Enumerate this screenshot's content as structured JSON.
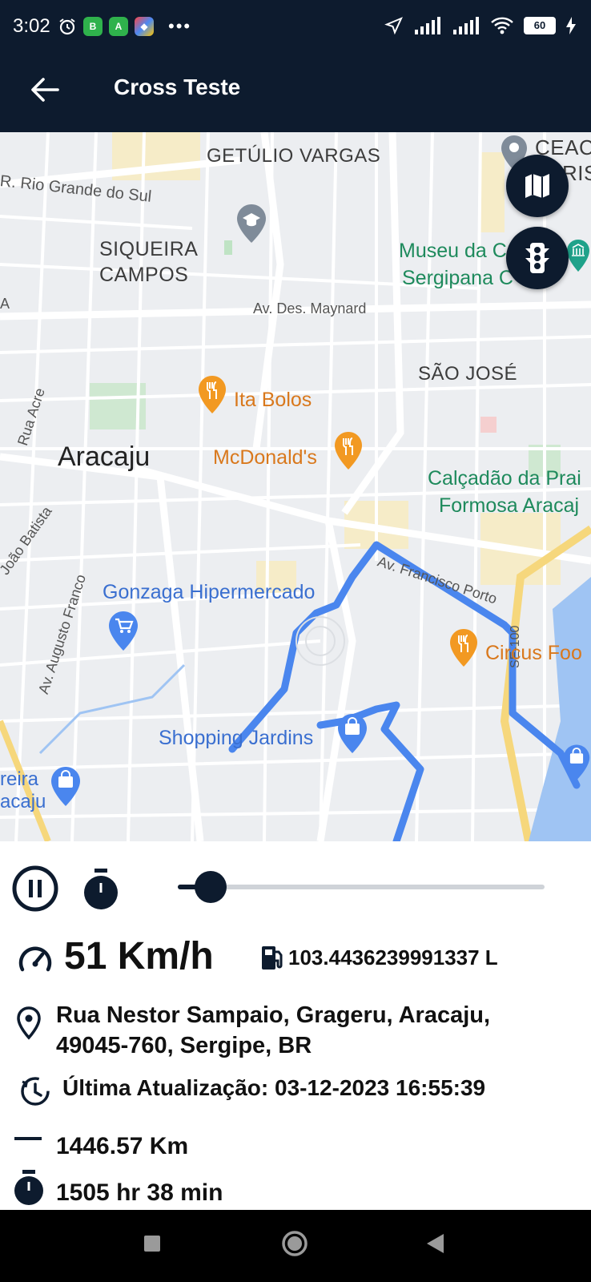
{
  "status_bar": {
    "time": "3:02",
    "battery": "60"
  },
  "app_bar": {
    "title": "Cross Teste"
  },
  "map": {
    "labels": {
      "getulio_vargas": "GETÚLIO VARGAS",
      "ceac": "CEAC",
      "ris": "RIS",
      "rio_grande_do_sul": "R. Rio Grande do Sul",
      "siqueira": "SIQUEIRA",
      "campos": "CAMPOS",
      "museu_line1": "Museu da C",
      "museu_line2": "Sergipana C",
      "av_maynard": "Av. Des. Maynard",
      "a": "A",
      "sao_jose": "SÃO JOSÉ",
      "rua_acre": "Rua Acre",
      "ita_bolos": "Ita Bolos",
      "aracaju": "Aracaju",
      "mcdonalds": "McDonald's",
      "calcadao_line1": "Calçadão da Prai",
      "calcadao_line2": "Formosa Aracaj",
      "joao_batista": "João Batista",
      "av_francisco_porto": "Av. Francisco Porto",
      "gonzaga": "Gonzaga Hipermercado",
      "av_augusto_franco": "Av. Augusto Franco",
      "se_100": "SE-100",
      "circus": "Circus Foo",
      "shopping_jardins": "Shopping Jardins",
      "reira": "reira",
      "acaju": "acaju"
    }
  },
  "colors": {
    "primary": "#0d1b2e",
    "route": "#4a86ee",
    "map_bg": "#eceef1"
  },
  "playback": {
    "progress": 0.09
  },
  "info": {
    "speed": "51 Km/h",
    "fuel": "103.4436239991337 L",
    "address": "Rua Nestor Sampaio, Grageru, Aracaju, 49045-760, Sergipe, BR",
    "last_update": "Última Atualização: 03-12-2023 16:55:39",
    "distance": "1446.57 Km",
    "duration": "1505 hr 38 min"
  }
}
